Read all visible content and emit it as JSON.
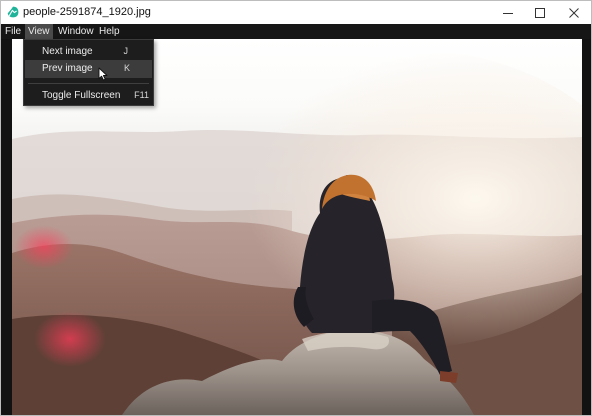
{
  "window": {
    "title": "people-2591874_1920.jpg",
    "controls": {
      "minimize": "minimize-icon",
      "maximize": "maximize-icon",
      "close": "close-icon"
    }
  },
  "menubar": {
    "items": [
      {
        "label": "File"
      },
      {
        "label": "View",
        "active": true
      },
      {
        "label": "Window"
      },
      {
        "label": "Help"
      }
    ]
  },
  "view_menu": {
    "items": [
      {
        "label": "Next image",
        "shortcut": "J"
      },
      {
        "label": "Prev image",
        "shortcut": "K",
        "hovered": true
      },
      {
        "label": "Toggle Fullscreen",
        "shortcut": "F11"
      }
    ]
  },
  "image": {
    "subject": "woman-sitting-on-rock-overlooking-misty-mountains"
  },
  "colors": {
    "app_icon": "#1fb39a",
    "menubar_bg": "#161616",
    "menu_bg": "#1d1d1d",
    "menu_hover": "#3c3c3c",
    "viewport_bg": "#121212"
  }
}
